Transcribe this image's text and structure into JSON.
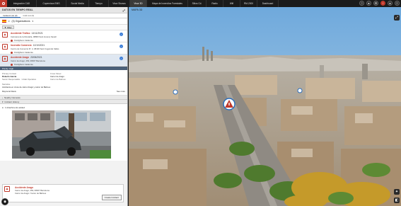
{
  "topnav": {
    "tabs": [
      "Integración CAD",
      "Copernicus EMS",
      "Social Media",
      "Tiempo",
      "Visor Sismos",
      "Visor 3D",
      "Mapa de Incendios Forestales",
      "Sitios Cd.",
      "Radio",
      "Wifi",
      "RM-2000",
      "Dashboard"
    ],
    "active_tab": "Visor 3D"
  },
  "left": {
    "header": "DATOS EN TIEMPO REAL",
    "tabs": [
      "Incident List (3)",
      "Grid List (3)"
    ],
    "org_label": "(3) Organizations",
    "filter_label": "Filter",
    "incidents": [
      {
        "title": "Accidente Trafico",
        "date": "14/11/2021",
        "address": "Carretera de la Montaña, 08860 Sant Llorenç Savall",
        "org": "Firefighters Catalonia"
      },
      {
        "title": "Incendio Comercio",
        "date": "12/10/2021",
        "address": "Centro de Comercio Pr. 4, 08190 Sant Cugat del Vallès",
        "org": "Firefighters Catalonia"
      },
      {
        "title": "Accidente Arago",
        "date": "20/06/2021",
        "address": "Carrer de Aragó, 269, 08007 Barcelona",
        "org": "Firefighters Catalonia"
      }
    ],
    "priority": "Priority: High",
    "detail": {
      "primary_contact_label": "Primary Contact",
      "primary_contact": "Roberto Garcia",
      "primary_sub": "Senior Responsable · Unitat Operativa",
      "cross_street_label": "Cross Street",
      "cross_street": "Carrer de Aragó",
      "cross_sub": "Carrer de Balmes",
      "narrative_label": "Narrative",
      "narrative": "Accidente en cruce de carrer Aragó y carrer de Balmes",
      "reporter": "Raymond Davis",
      "see_more": "See more"
    },
    "sections": [
      "Nearby Cameras",
      "Incident History"
    ],
    "feed_item": "1 Attachments added",
    "card": {
      "title": "Accidente Arago",
      "address": "Carrer de Aragó, 269, 08007 Barcelona",
      "sub": "Carrer de Aragó / Carrer de Balmes",
      "create": "Create Incident"
    }
  },
  "map": {
    "title": "MAPA 3D"
  }
}
